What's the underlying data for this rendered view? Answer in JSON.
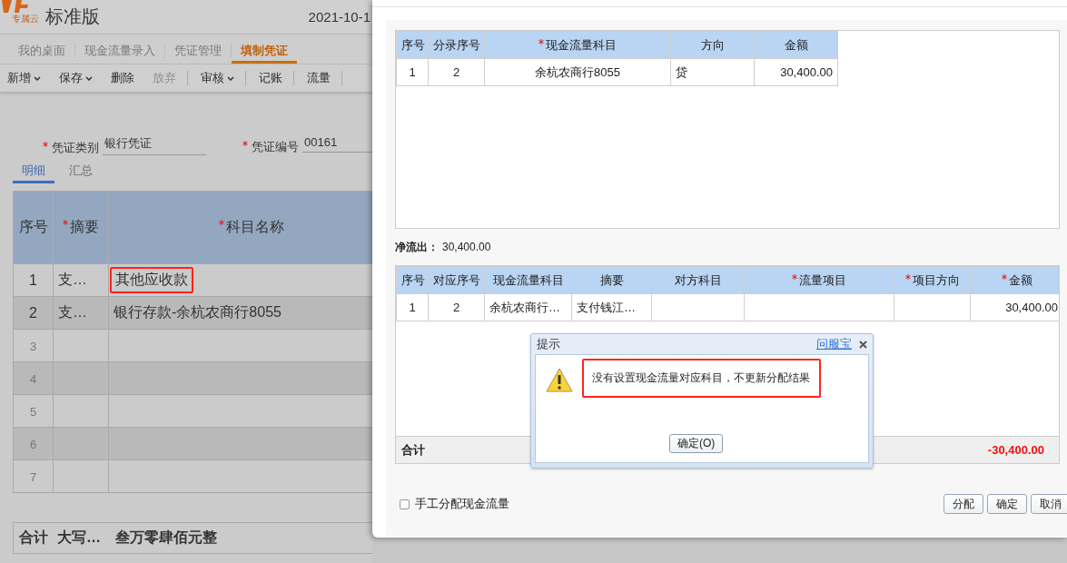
{
  "app": {
    "logo_badge": "专属云",
    "edition": "标准版",
    "date": "2021-10-1",
    "tabs": [
      {
        "label": "我的桌面",
        "selected": false
      },
      {
        "label": "现金流量录入",
        "selected": false
      },
      {
        "label": "凭证管理",
        "selected": false
      },
      {
        "label": "填制凭证",
        "selected": true
      }
    ],
    "toolbar": [
      {
        "label": "新增",
        "dropdown": true,
        "disabled": false,
        "divider_after": false
      },
      {
        "label": "保存",
        "dropdown": true,
        "disabled": false,
        "divider_after": false
      },
      {
        "label": "删除",
        "dropdown": false,
        "disabled": false,
        "divider_after": false
      },
      {
        "label": "放弃",
        "dropdown": false,
        "disabled": true,
        "divider_after": true
      },
      {
        "label": "审核",
        "dropdown": true,
        "disabled": false,
        "divider_after": true
      },
      {
        "label": "记账",
        "dropdown": false,
        "disabled": false,
        "divider_after": true
      },
      {
        "label": "流量",
        "dropdown": false,
        "disabled": false,
        "divider_after": true
      }
    ],
    "form": [
      {
        "label": "凭证类别",
        "required": true,
        "value": "银行凭证"
      },
      {
        "label": "凭证编号",
        "required": true,
        "value": "00161"
      }
    ],
    "subtabs": [
      {
        "label": "明细",
        "selected": true
      },
      {
        "label": "汇总",
        "selected": false
      }
    ],
    "voucher_table": {
      "columns": [
        {
          "label": "序号",
          "required": false
        },
        {
          "label": "摘要",
          "required": true
        },
        {
          "label": "科目名称",
          "required": true
        }
      ],
      "rows": [
        {
          "index": "1",
          "summary": "支…",
          "subject": "其他应收款",
          "highlighted": true
        },
        {
          "index": "2",
          "summary": "支…",
          "subject": "银行存款-余杭农商行8055",
          "highlighted": false
        },
        {
          "index": "3"
        },
        {
          "index": "4"
        },
        {
          "index": "5"
        },
        {
          "index": "6"
        },
        {
          "index": "7"
        }
      ]
    },
    "totals": {
      "label": "合计",
      "uppercase_label": "大写…",
      "amount_words": "叁万零肆佰元整"
    }
  },
  "flow_dialog": {
    "source_table": {
      "columns": [
        {
          "label": "序号",
          "required": false
        },
        {
          "label": "分录序号",
          "required": false
        },
        {
          "label": "现金流量科目",
          "required": true
        },
        {
          "label": "方向",
          "required": false
        },
        {
          "label": "金额",
          "required": false
        }
      ],
      "rows": [
        [
          "1",
          "2",
          "余杭农商行8055",
          "贷",
          "30,400.00"
        ]
      ]
    },
    "net_outflow": {
      "label": "净流出：",
      "value": "30,400.00"
    },
    "flow_table": {
      "columns": [
        {
          "label": "序号",
          "required": false
        },
        {
          "label": "对应序号",
          "required": false
        },
        {
          "label": "现金流量科目",
          "required": false
        },
        {
          "label": "摘要",
          "required": false
        },
        {
          "label": "对方科目",
          "required": false
        },
        {
          "label": "流量项目",
          "required": true
        },
        {
          "label": "项目方向",
          "required": true
        },
        {
          "label": "金额",
          "required": true
        }
      ],
      "rows": [
        [
          "1",
          "2",
          "余杭农商行…",
          "支付钱江…",
          null,
          null,
          null,
          "30,400.00"
        ]
      ],
      "total": {
        "label": "合计",
        "value": "-30,400.00"
      }
    },
    "manual_allocation": {
      "label": "手工分配现金流量",
      "checked": false
    },
    "buttons": [
      "分配",
      "确定",
      "取消"
    ]
  },
  "prompt": {
    "title": "提示",
    "help_link": "问服宝",
    "message": "没有设置现金流量对应科目，不更新分配结果",
    "highlighted": true,
    "button": "确定(O)"
  }
}
